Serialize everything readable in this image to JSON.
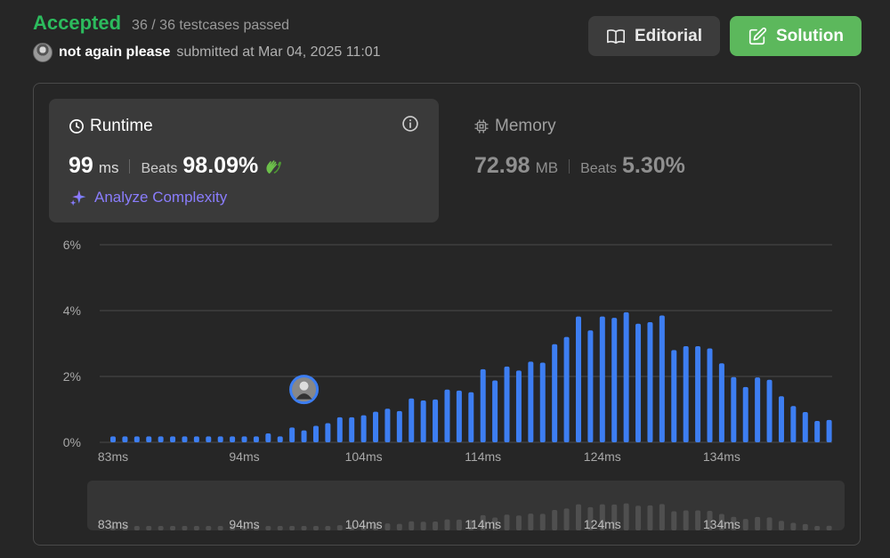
{
  "header": {
    "status": "Accepted",
    "testcases": "36 / 36 testcases passed",
    "username": "not again please",
    "submitted_text": "submitted at Mar 04, 2025 11:01"
  },
  "buttons": {
    "editorial": "Editorial",
    "solution": "Solution"
  },
  "runtime": {
    "title": "Runtime",
    "value": "99",
    "unit": "ms",
    "beats_label": "Beats",
    "beats_pct": "98.09%",
    "analyze": "Analyze Complexity"
  },
  "memory": {
    "title": "Memory",
    "value": "72.98",
    "unit": "MB",
    "beats_label": "Beats",
    "beats_pct": "5.30%"
  },
  "colors": {
    "accent": "#2cbb5d",
    "bar": "#3d7ef2",
    "solution_btn": "#5cb85c",
    "analyze": "#8a7dfc"
  },
  "chart_data": {
    "type": "bar",
    "x_tick_labels": [
      "83ms",
      "94ms",
      "104ms",
      "114ms",
      "124ms",
      "134ms"
    ],
    "x_tick_values": [
      83,
      94,
      104,
      114,
      124,
      134
    ],
    "y_tick_labels": [
      "0%",
      "2%",
      "4%",
      "6%"
    ],
    "ylim": [
      0,
      6
    ],
    "grid": true,
    "user_marker_x": 99,
    "x": [
      83,
      84,
      85,
      86,
      87,
      88,
      89,
      90,
      91,
      92,
      93,
      94,
      95,
      96,
      97,
      98,
      99,
      100,
      101,
      102,
      103,
      104,
      105,
      106,
      107,
      108,
      109,
      110,
      111,
      112,
      113,
      114,
      115,
      116,
      117,
      118,
      119,
      120,
      121,
      122,
      123,
      124,
      125,
      126,
      127,
      128,
      129,
      130,
      131,
      132,
      133,
      134,
      135,
      136,
      137,
      138,
      139,
      140,
      141,
      142,
      143,
      144
    ],
    "values": [
      0.18,
      0.18,
      0.18,
      0.18,
      0.18,
      0.18,
      0.18,
      0.18,
      0.18,
      0.18,
      0.18,
      0.18,
      0.18,
      0.27,
      0.18,
      0.45,
      0.36,
      0.5,
      0.58,
      0.76,
      0.76,
      0.82,
      0.93,
      1.02,
      0.95,
      1.33,
      1.27,
      1.3,
      1.6,
      1.57,
      1.52,
      2.22,
      1.88,
      2.3,
      2.18,
      2.45,
      2.42,
      2.98,
      3.2,
      3.82,
      3.4,
      3.82,
      3.78,
      3.95,
      3.6,
      3.65,
      3.85,
      2.8,
      2.92,
      2.92,
      2.85,
      2.4,
      1.98,
      1.68,
      1.97,
      1.9,
      1.4,
      1.1,
      0.92,
      0.65,
      0.68
    ]
  }
}
